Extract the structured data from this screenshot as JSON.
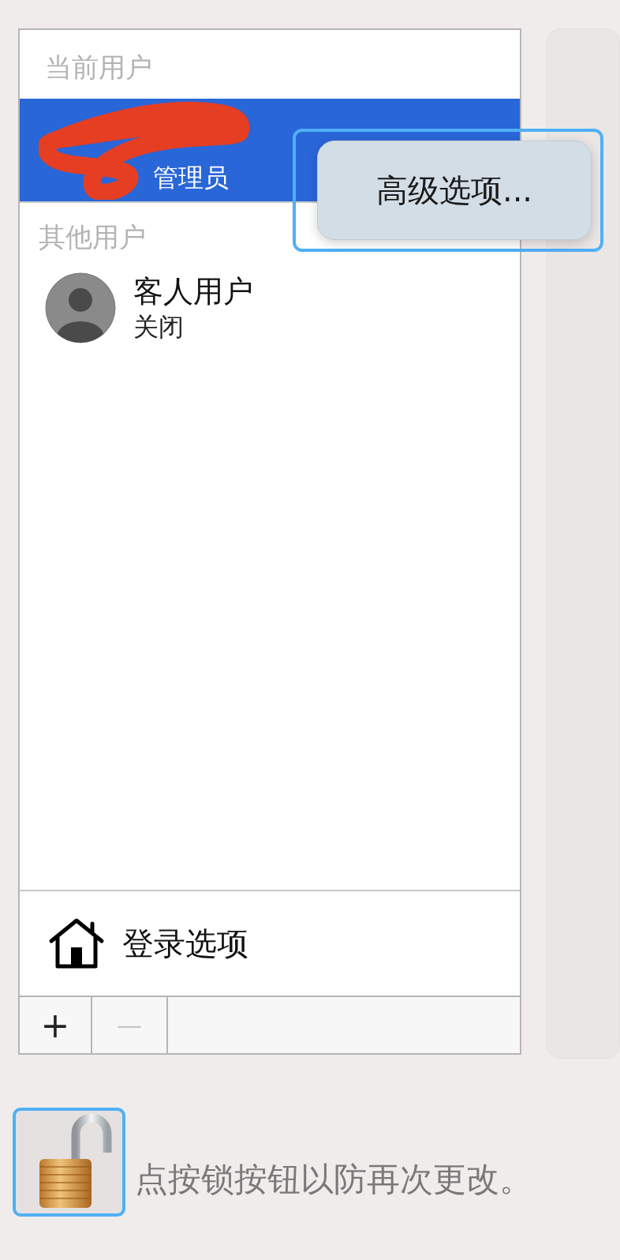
{
  "users_list": {
    "current_header": "当前用户",
    "current_user": {
      "role": "管理员",
      "selected": true
    },
    "other_header": "其他用户",
    "other_users": [
      {
        "name": "客人用户",
        "status": "关闭",
        "selected": false
      }
    ],
    "login_options": "登录选项",
    "add_button": {
      "label": "+",
      "disabled": false
    },
    "remove_button": {
      "label": "—",
      "disabled": true
    }
  },
  "popup_button": {
    "label": "高级选项...",
    "focused": true
  },
  "lock": {
    "focused": true,
    "locked": false,
    "message": "点按锁按钮以防再次更改。"
  }
}
